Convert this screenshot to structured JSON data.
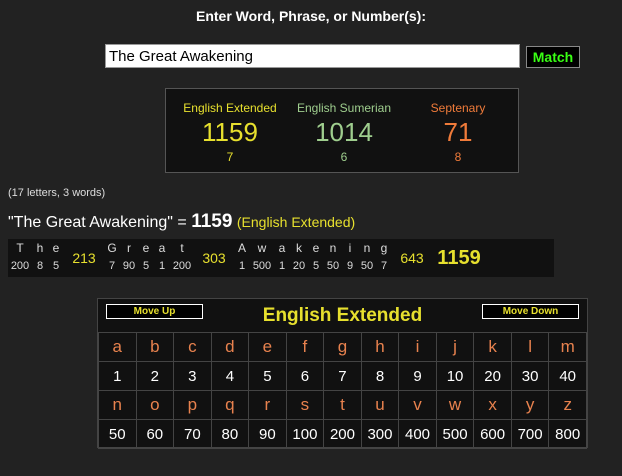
{
  "prompt": "Enter Word, Phrase, or Number(s):",
  "search": {
    "value": "The Great Awakening",
    "match_label": "Match"
  },
  "results": [
    {
      "name": "English Extended",
      "value": "1159",
      "sub": "7",
      "color": "#e7e02e"
    },
    {
      "name": "English Sumerian",
      "value": "1014",
      "sub": "6",
      "color": "#9fce8e"
    },
    {
      "name": "Septenary",
      "value": "71",
      "sub": "8",
      "color": "#f07b3a"
    }
  ],
  "stats": "(17 letters, 3 words)",
  "summary": {
    "phrase": "\"The Great Awakening\"",
    "equals": "=",
    "total": "1159",
    "cipher": "(English Extended)"
  },
  "breakdown": {
    "words": [
      {
        "letters": [
          [
            "T",
            "200"
          ],
          [
            "h",
            "8"
          ],
          [
            "e",
            "5"
          ]
        ],
        "total": "213"
      },
      {
        "letters": [
          [
            "G",
            "7"
          ],
          [
            "r",
            "90"
          ],
          [
            "e",
            "5"
          ],
          [
            "a",
            "1"
          ],
          [
            "t",
            "200"
          ]
        ],
        "total": "303"
      },
      {
        "letters": [
          [
            "A",
            "1"
          ],
          [
            "w",
            "500"
          ],
          [
            "a",
            "1"
          ],
          [
            "k",
            "20"
          ],
          [
            "e",
            "5"
          ],
          [
            "n",
            "50"
          ],
          [
            "i",
            "9"
          ],
          [
            "n",
            "50"
          ],
          [
            "g",
            "7"
          ]
        ],
        "total": "643"
      }
    ],
    "grand_total": "1159"
  },
  "cipher_table": {
    "title": "English Extended",
    "move_up": "Move Up",
    "move_down": "Move Down",
    "rows": [
      [
        "a",
        "b",
        "c",
        "d",
        "e",
        "f",
        "g",
        "h",
        "i",
        "j",
        "k",
        "l",
        "m"
      ],
      [
        "1",
        "2",
        "3",
        "4",
        "5",
        "6",
        "7",
        "8",
        "9",
        "10",
        "20",
        "30",
        "40"
      ],
      [
        "n",
        "o",
        "p",
        "q",
        "r",
        "s",
        "t",
        "u",
        "v",
        "w",
        "x",
        "y",
        "z"
      ],
      [
        "50",
        "60",
        "70",
        "80",
        "90",
        "100",
        "200",
        "300",
        "400",
        "500",
        "600",
        "700",
        "800"
      ]
    ]
  },
  "colors": {
    "background": "#222222",
    "accent": "#e7e02e",
    "letter": "#e8824e",
    "match": "#39ff14"
  }
}
